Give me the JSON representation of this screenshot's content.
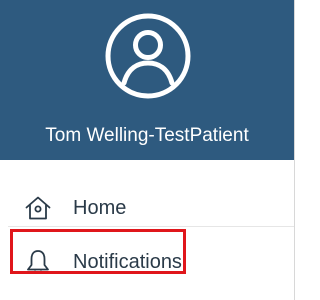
{
  "drawer": {
    "header": {
      "avatar_icon": "user-circle-icon",
      "user_name": "Tom Welling-TestPatient",
      "background_color": "#2e5a7f"
    },
    "menu": [
      {
        "label": "Home",
        "icon": "home-icon"
      },
      {
        "label": "Notifications",
        "icon": "bell-icon",
        "highlighted": true
      }
    ],
    "highlight_color": "#e0161b"
  }
}
